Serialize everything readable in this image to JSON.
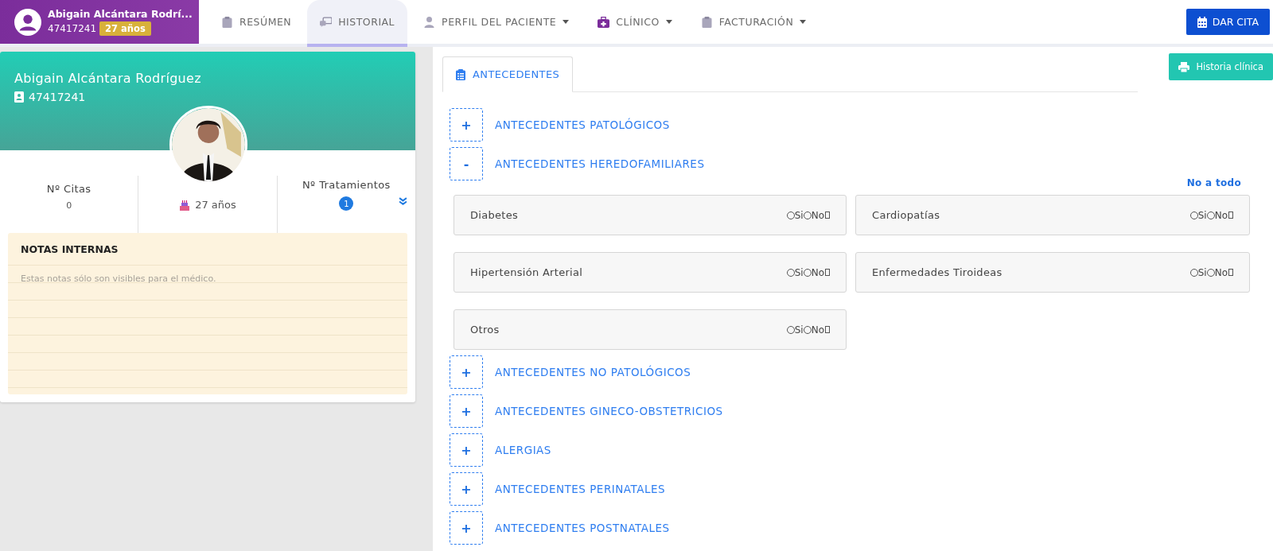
{
  "patient_badge": {
    "name": "Abigain Alcántara Rodrí...",
    "id": "47417241",
    "age": "27 años"
  },
  "nav": [
    {
      "label": "RESÚMEN",
      "selected": false,
      "dropdown": false
    },
    {
      "label": "HISTORIAL",
      "selected": true,
      "dropdown": false
    },
    {
      "label": "PERFIL DEL PACIENTE",
      "selected": false,
      "dropdown": true
    },
    {
      "label": "CLÍNICO",
      "selected": false,
      "dropdown": true
    },
    {
      "label": "FACTURACIÓN",
      "selected": false,
      "dropdown": true
    }
  ],
  "appointment_button": "DAR CITA",
  "profile": {
    "name": "Abigain Alcántara Rodríguez",
    "id": "47417241",
    "stats": [
      {
        "label": "Nº Citas",
        "value": "0",
        "kind": "plain"
      },
      {
        "value": "27 años",
        "kind": "age"
      },
      {
        "label": "Nº Tratamientos",
        "value": "1",
        "kind": "badge"
      }
    ]
  },
  "notes": {
    "title": "NOTAS INTERNAS",
    "placeholder": "Estas notas sólo son visibles para el médico."
  },
  "tabs": [
    {
      "label": "ANTECEDENTES",
      "selected": true
    }
  ],
  "print_button": "Historia clínica",
  "sections": [
    {
      "toggle": "+",
      "title": "ANTECEDENTES PATOLÓGICOS"
    },
    {
      "toggle": "-",
      "title": "ANTECEDENTES HEREDOFAMILIARES",
      "all_no_link": "No a todo",
      "items": [
        {
          "label": "Diabetes",
          "options": [
            {
              "label": "Si",
              "checked": false
            },
            {
              "label": "No",
              "checked": false
            }
          ]
        },
        {
          "label": "Cardiopatías",
          "options": [
            {
              "label": "Si",
              "checked": false
            },
            {
              "label": "No",
              "checked": false
            }
          ]
        },
        {
          "label": "Hipertensión Arterial",
          "options": [
            {
              "label": "Si",
              "checked": false
            },
            {
              "label": "No",
              "checked": false
            }
          ]
        },
        {
          "label": "Enfermedades Tiroideas",
          "options": [
            {
              "label": "Si",
              "checked": false
            },
            {
              "label": "No",
              "checked": false
            }
          ]
        },
        {
          "label": "Otros",
          "options": [
            {
              "label": "Si",
              "checked": false
            },
            {
              "label": "No",
              "checked": false
            }
          ]
        }
      ]
    },
    {
      "toggle": "+",
      "title": "ANTECEDENTES NO PATOLÓGICOS"
    },
    {
      "toggle": "+",
      "title": "ANTECEDENTES GINECO-OBSTETRICIOS"
    },
    {
      "toggle": "+",
      "title": "ALERGIAS"
    },
    {
      "toggle": "+",
      "title": "ANTECEDENTES PERINATALES"
    },
    {
      "toggle": "+",
      "title": "ANTECEDENTES POSTNATALES"
    }
  ]
}
